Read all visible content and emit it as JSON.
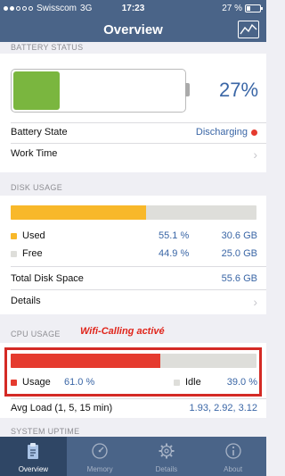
{
  "status_bar": {
    "carrier": "Swisscom",
    "network": "3G",
    "time": "17:23",
    "battery_percent": "27 %"
  },
  "nav": {
    "title": "Overview"
  },
  "battery_status": {
    "header": "BATTERY STATUS",
    "level_percent": "27%",
    "level_fraction": 0.27,
    "state_label": "Battery State",
    "state_value": "Discharging",
    "work_time_label": "Work Time"
  },
  "disk_usage": {
    "header": "DISK USAGE",
    "used_fraction": 0.551,
    "used_label": "Used",
    "used_pct": "55.1 %",
    "used_size": "30.6 GB",
    "free_label": "Free",
    "free_pct": "44.9 %",
    "free_size": "25.0 GB",
    "total_label": "Total Disk Space",
    "total_value": "55.6 GB",
    "details_label": "Details"
  },
  "cpu_usage": {
    "header": "CPU USAGE",
    "annotation": "Wifi-Calling activé",
    "usage_fraction": 0.61,
    "usage_label": "Usage",
    "usage_pct": "61.0 %",
    "idle_label": "Idle",
    "idle_pct": "39.0 %",
    "avg_load_label": "Avg Load (1, 5, 15 min)",
    "avg_load_value": "1.93, 2.92, 3.12"
  },
  "system_uptime": {
    "header": "SYSTEM UPTIME"
  },
  "colors": {
    "nav": "#4a6488",
    "battery": "#7ab63f",
    "disk_used": "#f8b82a",
    "disk_free": "#dededa",
    "cpu_usage": "#e53b2f",
    "accent": "#3a66a6"
  },
  "tabs": [
    {
      "label": "Overview",
      "icon": "clipboard-icon",
      "active": true
    },
    {
      "label": "Memory",
      "icon": "gauge-icon",
      "active": false
    },
    {
      "label": "Details",
      "icon": "gear-icon",
      "active": false
    },
    {
      "label": "About",
      "icon": "info-icon",
      "active": false
    }
  ]
}
